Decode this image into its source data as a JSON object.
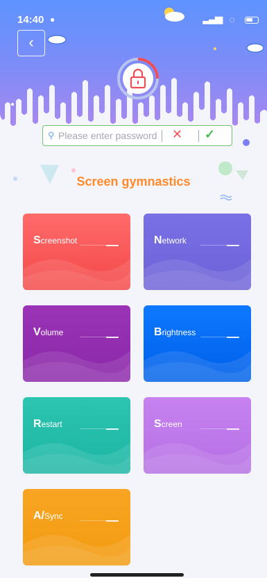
{
  "status_bar": {
    "time": "14:40"
  },
  "search": {
    "placeholder": "Please enter password"
  },
  "title": "Screen gymnastics",
  "cards": [
    {
      "initial": "S",
      "rest": "creenshot",
      "color_top": "#ff6b6b",
      "color_bottom": "#f44848"
    },
    {
      "initial": "N",
      "rest": "etwork",
      "color_top": "#7a70e6",
      "color_bottom": "#6d62d8"
    },
    {
      "initial": "V",
      "rest": "olume",
      "color_top": "#9b34b6",
      "color_bottom": "#8a27a9"
    },
    {
      "initial": "B",
      "rest": "rightness",
      "color_top": "#0d79ff",
      "color_bottom": "#005fe8"
    },
    {
      "initial": "R",
      "rest": "estart",
      "color_top": "#2cc5b1",
      "color_bottom": "#1cb5a3"
    },
    {
      "initial": "S",
      "rest": "creen",
      "color_top": "#c782f0",
      "color_bottom": "#b56fe4"
    },
    {
      "initial": "A/",
      "rest": "Sync",
      "color_top": "#f8a523",
      "color_bottom": "#f39b10"
    }
  ]
}
